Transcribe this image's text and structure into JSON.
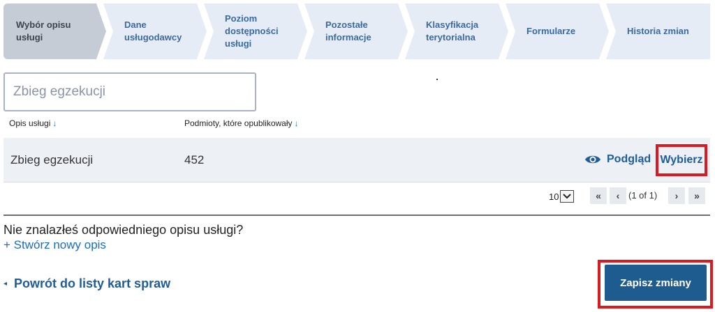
{
  "steps": [
    {
      "label": "Wybór opisu\nusługi"
    },
    {
      "label": "Dane\nusługodawcy"
    },
    {
      "label": "Poziom\ndostępności\nusługi"
    },
    {
      "label": "Pozostałe\ninformacje"
    },
    {
      "label": "Klasyfikacja\nterytorialna"
    },
    {
      "label": "Formularze"
    },
    {
      "label": "Historia zmian"
    }
  ],
  "search": {
    "placeholder": "Zbieg egzekucji"
  },
  "table": {
    "columns": [
      {
        "label": "Opis usługi",
        "sort_icon": "↓"
      },
      {
        "label": "Podmioty, które opublikowały",
        "sort_icon": "↓"
      }
    ],
    "rows": [
      {
        "description": "Zbieg egzekucji",
        "count": "452",
        "preview_label": "Podgląd",
        "choose_label": "Wybierz"
      }
    ]
  },
  "pagination": {
    "page_size": "10",
    "first": "«",
    "prev": "‹",
    "info": "(1 of 1)",
    "next": "›",
    "last": "»"
  },
  "footer": {
    "not_found_text": "Nie znalazłeś odpowiedniego opisu usługi?",
    "create_link": "+ Stwórz nowy opis",
    "back_icon": "◂",
    "back_label": "Powrót do listy kart spraw",
    "save_label": "Zapisz zmiany"
  },
  "colors": {
    "accent": "#1e5c9b",
    "highlight": "#d81a22",
    "step_active": "#c6ccd6",
    "step_inactive": "#e6ecf5"
  }
}
